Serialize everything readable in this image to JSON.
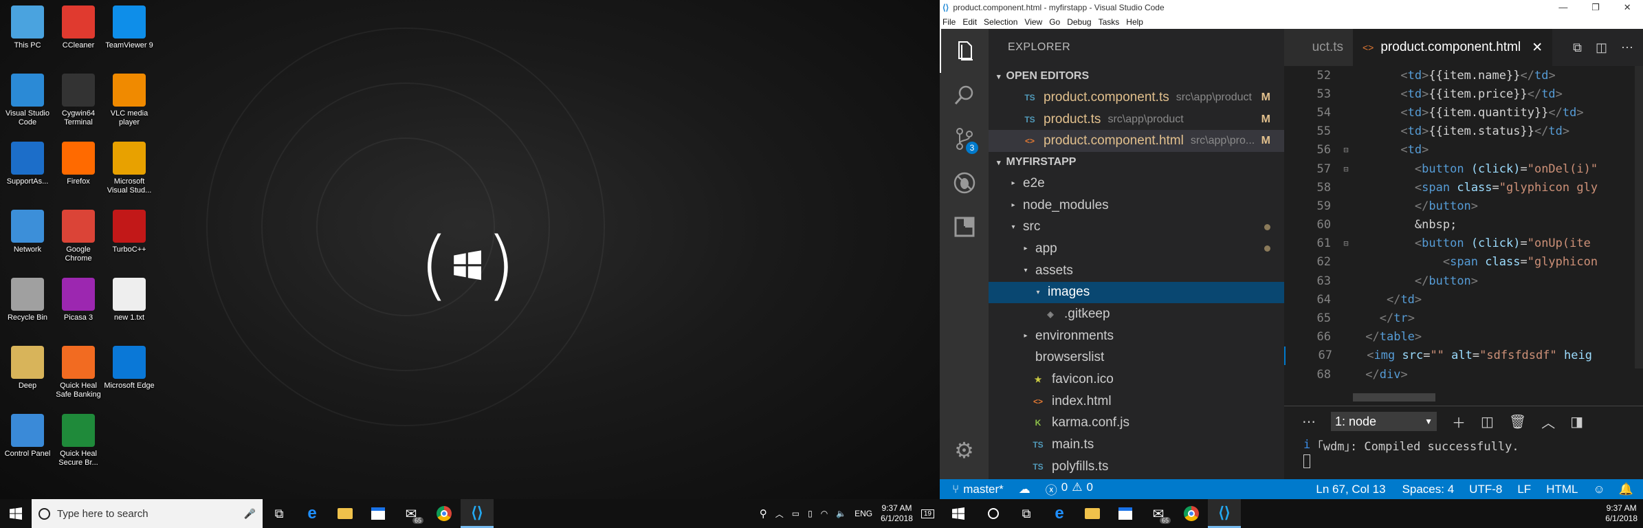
{
  "desktop": {
    "icons": [
      {
        "label": "This PC",
        "icon": "computer-icon",
        "color": "#4aa3df"
      },
      {
        "label": "CCleaner",
        "icon": "ccleaner-icon",
        "color": "#e03a2f"
      },
      {
        "label": "TeamViewer 9",
        "icon": "teamviewer-icon",
        "color": "#0e8ee9"
      },
      {
        "label": "Visual Studio Code",
        "icon": "vscode-icon",
        "color": "#2b8ad6"
      },
      {
        "label": "Cygwin64 Terminal",
        "icon": "terminal-icon",
        "color": "#333333"
      },
      {
        "label": "VLC media player",
        "icon": "vlc-icon",
        "color": "#f08a00"
      },
      {
        "label": "SupportAs...",
        "icon": "support-icon",
        "color": "#1c6ec9"
      },
      {
        "label": "Firefox",
        "icon": "firefox-icon",
        "color": "#ff6a00"
      },
      {
        "label": "Microsoft Visual Stud...",
        "icon": "visual-studio-icon",
        "color": "#e8a100"
      },
      {
        "label": "Network",
        "icon": "network-icon",
        "color": "#3c8fd9"
      },
      {
        "label": "Google Chrome",
        "icon": "chrome-icon",
        "color": "#db4437"
      },
      {
        "label": "TurboC++",
        "icon": "turboc-icon",
        "color": "#c21818"
      },
      {
        "label": "Recycle Bin",
        "icon": "recycle-bin-icon",
        "color": "#a0a0a0"
      },
      {
        "label": "Picasa 3",
        "icon": "picasa-icon",
        "color": "#9c27b0"
      },
      {
        "label": "new 1.txt",
        "icon": "text-file-icon",
        "color": "#eeeeee"
      },
      {
        "label": "Deep",
        "icon": "folder-user-icon",
        "color": "#d8b45a"
      },
      {
        "label": "Quick Heal Safe Banking",
        "icon": "quickheal-banking-icon",
        "color": "#f26b21"
      },
      {
        "label": "Microsoft Edge",
        "icon": "edge-icon",
        "color": "#0a78d7"
      },
      {
        "label": "Control Panel",
        "icon": "control-panel-icon",
        "color": "#3a8ad8"
      },
      {
        "label": "Quick Heal Secure Br...",
        "icon": "quickheal-browser-icon",
        "color": "#1f8a3a"
      }
    ]
  },
  "taskbar_left": {
    "search_placeholder": "Type here to search",
    "tray_lang": "ENG",
    "clock_time": "9:37 AM",
    "clock_date": "6/1/2018",
    "notif_count": "19",
    "mail_count": "65"
  },
  "taskbar_right": {
    "clock_time": "9:37 AM",
    "clock_date": "6/1/2018",
    "mail_count": "65"
  },
  "vscode": {
    "title": "product.component.html - myfirstapp - Visual Studio Code",
    "menu": [
      "File",
      "Edit",
      "Selection",
      "View",
      "Go",
      "Debug",
      "Tasks",
      "Help"
    ],
    "scm_badge": "3",
    "explorer_title": "EXPLORER",
    "open_editors_label": "OPEN EDITORS",
    "open_editors": [
      {
        "icon": "TS",
        "name": "product.component.ts",
        "path": "src\\app\\product",
        "mod": "M"
      },
      {
        "icon": "TS",
        "name": "product.ts",
        "path": "src\\app\\product",
        "mod": "M"
      },
      {
        "icon": "<>",
        "name": "product.component.html",
        "path": "src\\app\\pro...",
        "mod": "M"
      }
    ],
    "project_label": "MYFIRSTAPP",
    "tree": [
      {
        "name": "e2e",
        "twist": "▸",
        "indent": 0
      },
      {
        "name": "node_modules",
        "twist": "▸",
        "indent": 0
      },
      {
        "name": "src",
        "twist": "▾",
        "indent": 0
      },
      {
        "name": "app",
        "twist": "▸",
        "indent": 1
      },
      {
        "name": "assets",
        "twist": "▾",
        "indent": 1
      },
      {
        "name": "images",
        "twist": "▾",
        "indent": 2
      },
      {
        "name": ".gitkeep",
        "twist": "",
        "indent": 2
      },
      {
        "name": "environments",
        "twist": "▸",
        "indent": 1
      },
      {
        "name": "browserslist",
        "twist": "",
        "indent": 1
      },
      {
        "name": "favicon.ico",
        "twist": "",
        "indent": 1
      },
      {
        "name": "index.html",
        "twist": "",
        "indent": 1
      },
      {
        "name": "karma.conf.js",
        "twist": "",
        "indent": 1
      },
      {
        "name": "main.ts",
        "twist": "",
        "indent": 1
      },
      {
        "name": "polyfills.ts",
        "twist": "",
        "indent": 1
      }
    ],
    "tabs": {
      "inactive": "uct.ts",
      "active": "product.component.html"
    },
    "code_lines": [
      {
        "n": "52",
        "fold": "",
        "html": "      <span class='br'>&lt;</span><span class='tag'>td</span><span class='br'>&gt;</span><span class='tx'>{{item.name}}</span><span class='br'>&lt;/</span><span class='tag'>td</span><span class='br'>&gt;</span>"
      },
      {
        "n": "53",
        "fold": "",
        "html": "      <span class='br'>&lt;</span><span class='tag'>td</span><span class='br'>&gt;</span><span class='tx'>{{item.price}}</span><span class='br'>&lt;/</span><span class='tag'>td</span><span class='br'>&gt;</span>"
      },
      {
        "n": "54",
        "fold": "",
        "html": "      <span class='br'>&lt;</span><span class='tag'>td</span><span class='br'>&gt;</span><span class='tx'>{{item.quantity}}</span><span class='br'>&lt;/</span><span class='tag'>td</span><span class='br'>&gt;</span>"
      },
      {
        "n": "55",
        "fold": "",
        "html": "      <span class='br'>&lt;</span><span class='tag'>td</span><span class='br'>&gt;</span><span class='tx'>{{item.status}}</span><span class='br'>&lt;/</span><span class='tag'>td</span><span class='br'>&gt;</span>"
      },
      {
        "n": "56",
        "fold": "⊟",
        "html": "      <span class='br'>&lt;</span><span class='tag'>td</span><span class='br'>&gt;</span>"
      },
      {
        "n": "57",
        "fold": "⊟",
        "html": "        <span class='br'>&lt;</span><span class='tag'>button</span> <span class='at'>(click)</span><span class='tx'>=</span><span class='st'>\"onDel(i)\"</span>"
      },
      {
        "n": "58",
        "fold": "",
        "html": "        <span class='br'>&lt;</span><span class='tag'>span</span> <span class='at'>class</span><span class='tx'>=</span><span class='st'>\"glyphicon gly</span>"
      },
      {
        "n": "59",
        "fold": "",
        "html": "        <span class='br'>&lt;/</span><span class='tag'>button</span><span class='br'>&gt;</span>"
      },
      {
        "n": "60",
        "fold": "",
        "html": "        <span class='tx'>&amp;nbsp;</span>"
      },
      {
        "n": "61",
        "fold": "⊟",
        "html": "        <span class='br'>&lt;</span><span class='tag'>button</span> <span class='at'>(click)</span><span class='tx'>=</span><span class='st'>\"onUp(ite</span>"
      },
      {
        "n": "62",
        "fold": "",
        "html": "            <span class='br'>&lt;</span><span class='tag'>span</span> <span class='at'>class</span><span class='tx'>=</span><span class='st'>\"glyphicon</span>"
      },
      {
        "n": "63",
        "fold": "",
        "html": "        <span class='br'>&lt;/</span><span class='tag'>button</span><span class='br'>&gt;</span>"
      },
      {
        "n": "64",
        "fold": "",
        "html": "    <span class='br'>&lt;/</span><span class='tag'>td</span><span class='br'>&gt;</span>"
      },
      {
        "n": "65",
        "fold": "",
        "html": "   <span class='br'>&lt;/</span><span class='tag'>tr</span><span class='br'>&gt;</span>"
      },
      {
        "n": "66",
        "fold": "",
        "html": " <span class='br'>&lt;/</span><span class='tag'>table</span><span class='br'>&gt;</span>"
      },
      {
        "n": "67",
        "fold": "",
        "html": " <span class='br'>&lt;</span><span class='tag'>img</span> <span class='at'>src</span><span class='tx'>=</span><span class='st'>\"\"</span> <span class='at'>alt</span><span class='tx'>=</span><span class='st'>\"sdfsfdsdf\"</span> <span class='at'>heig</span>"
      },
      {
        "n": "68",
        "fold": "",
        "html": " <span class='br'>&lt;/</span><span class='tag'>div</span><span class='br'>&gt;</span>"
      }
    ],
    "terminal_select": "1: node",
    "terminal_output": "｢wdm｣: Compiled successfully.",
    "terminal_prefix": "i",
    "status": {
      "branch": "master*",
      "errors": "0",
      "warnings": "0",
      "position": "Ln 67, Col 13",
      "spaces": "Spaces: 4",
      "encoding": "UTF-8",
      "eol": "LF",
      "language": "HTML"
    }
  }
}
